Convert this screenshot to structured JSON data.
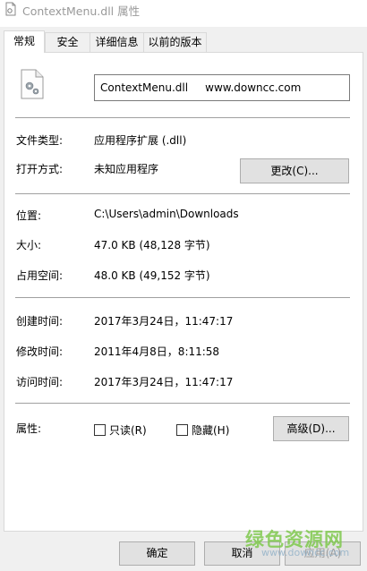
{
  "window": {
    "title": "ContextMenu.dll 属性"
  },
  "tabs": [
    {
      "label": "常规",
      "active": true
    },
    {
      "label": "安全",
      "active": false
    },
    {
      "label": "详细信息",
      "active": false
    },
    {
      "label": "以前的版本",
      "active": false
    }
  ],
  "general": {
    "file_name": "ContextMenu.dll     www.downcc.com",
    "file_type_label": "文件类型:",
    "file_type_value": "应用程序扩展 (.dll)",
    "open_with_label": "打开方式:",
    "open_with_value": "未知应用程序",
    "change_button": "更改(C)...",
    "location_label": "位置:",
    "location_value": "C:\\Users\\admin\\Downloads",
    "size_label": "大小:",
    "size_value": "47.0 KB (48,128 字节)",
    "size_on_disk_label": "占用空间:",
    "size_on_disk_value": "48.0 KB (49,152 字节)",
    "created_label": "创建时间:",
    "created_value": "2017年3月24日，11:47:17",
    "modified_label": "修改时间:",
    "modified_value": "2011年4月8日，8:11:58",
    "accessed_label": "访问时间:",
    "accessed_value": "2017年3月24日，11:47:17",
    "attributes_label": "属性:",
    "readonly_label": "只读(R)",
    "readonly_checked": false,
    "hidden_label": "隐藏(H)",
    "hidden_checked": false,
    "advanced_button": "高级(D)..."
  },
  "footer": {
    "ok_button": "确定",
    "cancel_button": "取消",
    "apply_button": "应用(A)"
  },
  "watermark": {
    "text": "绿色资源网",
    "url": "www.downcc.com"
  },
  "icons": {
    "title_icon": "dll-file-icon",
    "file_icon": "dll-gear-file-icon"
  }
}
